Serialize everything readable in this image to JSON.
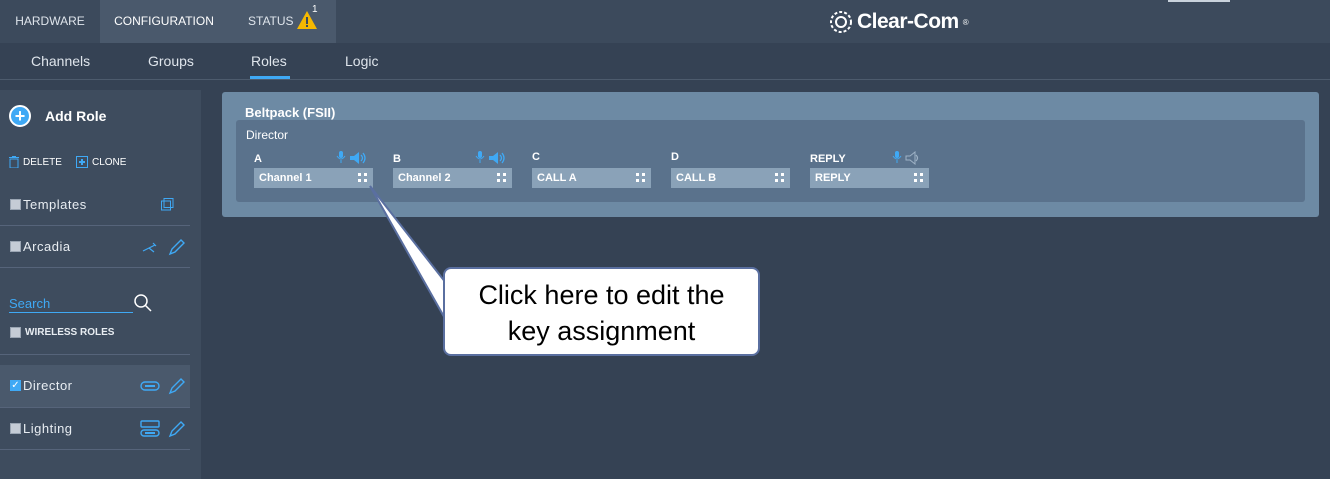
{
  "topnav": {
    "tabs": [
      {
        "label": "HARDWARE"
      },
      {
        "label": "CONFIGURATION"
      },
      {
        "label": "STATUS"
      }
    ],
    "status_alert_count": "1",
    "logo": "Clear-Com",
    "logo_reg": "®"
  },
  "subnav": {
    "tabs": [
      {
        "label": "Channels"
      },
      {
        "label": "Groups"
      },
      {
        "label": "Roles"
      },
      {
        "label": "Logic"
      }
    ]
  },
  "sidebar": {
    "add_role_label": "Add Role",
    "delete_label": "DELETE",
    "clone_label": "CLONE",
    "templates_label": "Templates",
    "arcadia_label": "Arcadia",
    "search_placeholder": "Search",
    "wireless_roles_label": "WIRELESS ROLES",
    "roles": [
      {
        "label": "Director",
        "checked": true
      },
      {
        "label": "Lighting",
        "checked": false
      }
    ]
  },
  "main": {
    "device_title": "Beltpack (FSII)",
    "role_name": "Director",
    "keys": [
      {
        "label": "A",
        "assignment": "Channel 1"
      },
      {
        "label": "B",
        "assignment": "Channel 2"
      },
      {
        "label": "C",
        "assignment": "CALL A"
      },
      {
        "label": "D",
        "assignment": "CALL B"
      },
      {
        "label": "REPLY",
        "assignment": "REPLY"
      }
    ]
  },
  "callout": {
    "line1": "Click here to edit the",
    "line2": "key assignment"
  },
  "colors": {
    "accent": "#3fa9f5",
    "warning": "#f5b800"
  }
}
